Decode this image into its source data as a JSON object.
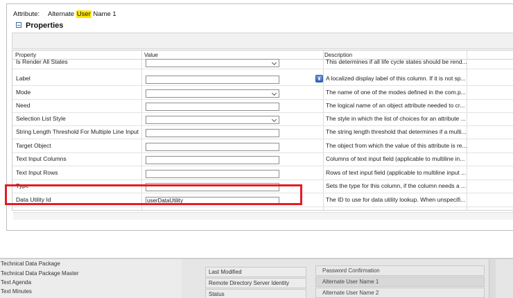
{
  "attribute": {
    "label": "Attribute:",
    "name_before": "Alternate ",
    "name_highlight": "User",
    "name_after": " Name 1"
  },
  "properties": {
    "title": "Properties"
  },
  "grid": {
    "columns": [
      "Property",
      "Value",
      "Description"
    ],
    "rows": [
      {
        "name": "Is Render All States",
        "value": "",
        "type": "select",
        "desc": "This determines if all life cycle states should be rend..."
      },
      {
        "name": "Label",
        "value": "",
        "type": "text",
        "info_icon": "info-icon",
        "desc": "A localized display label of this column. If it is not sp..."
      },
      {
        "name": "Mode",
        "value": "",
        "type": "select",
        "desc": "The name of one of the modes defined in the com.p..."
      },
      {
        "name": "Need",
        "value": "",
        "type": "text",
        "desc": "The logical name of an object attribute needed to cr..."
      },
      {
        "name": "Selection List Style",
        "value": "",
        "type": "select",
        "desc": "The style in which the list of choices for an attribute ..."
      },
      {
        "name": "String Length Threshold For Multiple Line Input",
        "value": "",
        "type": "text",
        "desc": "The string length threshold that determines if a multi..."
      },
      {
        "name": "Target Object",
        "value": "",
        "type": "text",
        "desc": "The object from which the value of this attribute is re..."
      },
      {
        "name": "Text Input Columns",
        "value": "",
        "type": "text",
        "desc": "Columns of text input field (applicable to multiline in..."
      },
      {
        "name": "Text Input Rows",
        "value": "",
        "type": "text",
        "desc": "Rows of text input field (applicable to multiline input ..."
      },
      {
        "name": "Type",
        "value": "",
        "type": "text",
        "desc": "Sets the type for this column, if the column needs a ..."
      },
      {
        "name": "Data Utility Id",
        "value": "userDataUtility",
        "type": "text",
        "desc": "The ID to use for data utility lookup. When unspecifi..."
      }
    ]
  },
  "highlight": {
    "color": "#e41b23"
  },
  "background_app": {
    "list_items": [
      "Technical Data Package",
      "Technical Data Package Master",
      "Text Agenda",
      "Text Minutes"
    ],
    "column2": [
      "Last Modified",
      "Remote Directory Server Identity",
      "Status"
    ],
    "column3": [
      "Password Confirmation",
      "Alternate User Name 1",
      "Alternate User Name 2"
    ]
  }
}
